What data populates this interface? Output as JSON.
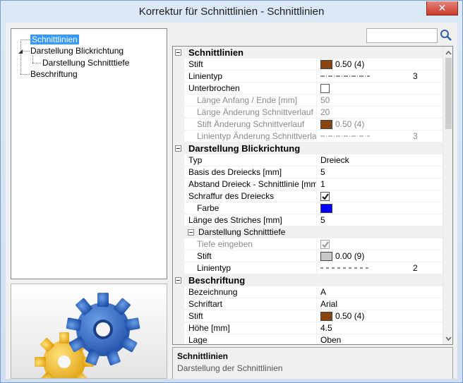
{
  "window": {
    "title": "Korrektur für Schnittlinien - Schnittlinien",
    "close_label": "✕"
  },
  "tree": {
    "items": [
      {
        "label": "Schnittlinien",
        "selected": true
      },
      {
        "label": "Darstellung Blickrichtung",
        "selected": false
      },
      {
        "label": "Darstellung Schnitttiefe",
        "selected": false
      },
      {
        "label": "Beschriftung",
        "selected": false
      }
    ]
  },
  "search": {
    "value": "",
    "placeholder": ""
  },
  "grid": {
    "sections": [
      {
        "title": "Schnittlinien",
        "rows": [
          {
            "name": "Stift",
            "kind": "pen",
            "color": "#8b4513",
            "value": "0.50 (4)"
          },
          {
            "name": "Linientyp",
            "kind": "line",
            "value": "3"
          },
          {
            "name": "Unterbrochen",
            "kind": "checkbox",
            "checked": false
          },
          {
            "name": "Länge Anfang / Ende [mm]",
            "kind": "text",
            "value": "50",
            "disabled": true,
            "indent": 1
          },
          {
            "name": "Länge Änderung Schnittverlauf [...",
            "kind": "text",
            "value": "20",
            "disabled": true,
            "indent": 1
          },
          {
            "name": "Stift Änderung Schnittverlauf",
            "kind": "pen",
            "color": "#8b4513",
            "value": "0.50 (4)",
            "disabled": true,
            "indent": 1
          },
          {
            "name": "Linientyp Änderung Schnittverlauf",
            "kind": "line",
            "value": "3",
            "disabled": true,
            "indent": 1
          }
        ]
      },
      {
        "title": "Darstellung Blickrichtung",
        "rows": [
          {
            "name": "Typ",
            "kind": "text",
            "value": "Dreieck"
          },
          {
            "name": "Basis des Dreiecks [mm]",
            "kind": "text",
            "value": "5"
          },
          {
            "name": "Abstand Dreieck - Schnittlinie [mm]",
            "kind": "text",
            "value": "1"
          },
          {
            "name": "Schraffur des Dreiecks",
            "kind": "checkbox",
            "checked": true
          },
          {
            "name": "Farbe",
            "kind": "color",
            "color": "#0000ff",
            "indent": 1
          },
          {
            "name": "Länge des Striches [mm]",
            "kind": "text",
            "value": "5"
          },
          {
            "name": "Darstellung Schnitttiefe",
            "kind": "subcat"
          },
          {
            "name": "Tiefe eingeben",
            "kind": "checkbox",
            "checked": true,
            "disabled": true,
            "indent": 1
          },
          {
            "name": "Stift",
            "kind": "pen",
            "color": "#c8c8c8",
            "value": "0.00 (9)",
            "indent": 1
          },
          {
            "name": "Linientyp",
            "kind": "line2",
            "value": "2",
            "indent": 1
          }
        ]
      },
      {
        "title": "Beschriftung",
        "rows": [
          {
            "name": "Bezeichnung",
            "kind": "text",
            "value": "A"
          },
          {
            "name": "Schriftart",
            "kind": "text",
            "value": "Arial"
          },
          {
            "name": "Stift",
            "kind": "pen",
            "color": "#8b4513",
            "value": "0.50 (4)"
          },
          {
            "name": "Höhe [mm]",
            "kind": "text",
            "value": "4.5"
          },
          {
            "name": "Lage",
            "kind": "text",
            "value": "Oben"
          }
        ]
      }
    ]
  },
  "description": {
    "title": "Schnittlinien",
    "text": "Darstellung der Schnittlinien"
  },
  "icons": [
    "close-icon",
    "search-icon",
    "gear-icon",
    "collapse-icon",
    "checkbox-check-icon",
    "scroll-up-icon",
    "scroll-down-icon"
  ]
}
